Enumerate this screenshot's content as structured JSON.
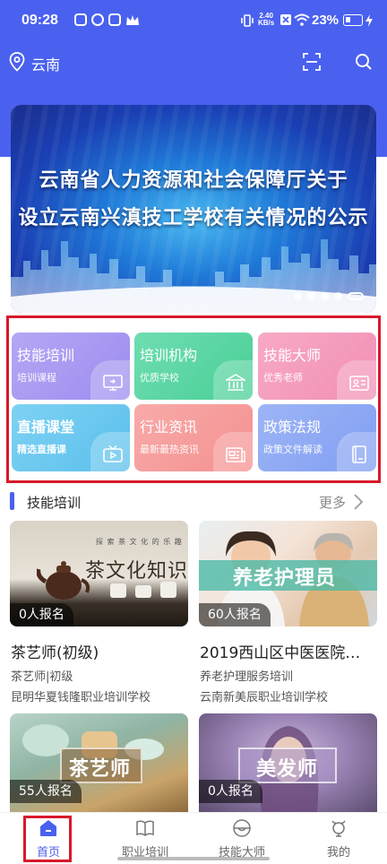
{
  "status_bar": {
    "time": "09:28",
    "net_speed_value": "2.40",
    "net_speed_unit": "KB/s",
    "battery": "23%"
  },
  "location": {
    "city": "云南"
  },
  "banner": {
    "line1": "云南省人力资源和社会保障厅关于",
    "line2": "设立云南兴滇技工学校有关情况的公示"
  },
  "categories": [
    {
      "title": "技能培训",
      "subtitle": "培训课程",
      "icon": "monitor-icon",
      "color_from": "#b6a6f4",
      "color_to": "#9d8df0"
    },
    {
      "title": "培训机构",
      "subtitle": "优质学校",
      "icon": "bank-icon",
      "color_from": "#6fddb1",
      "color_to": "#49cf97"
    },
    {
      "title": "技能大师",
      "subtitle": "优秀老师",
      "icon": "id-card-icon",
      "color_from": "#f7a9c6",
      "color_to": "#f28fb4"
    },
    {
      "title": "直播课堂",
      "subtitle": "精选直播课",
      "icon": "tv-play-icon",
      "color_from": "#7ed2f3",
      "color_to": "#5bbfec"
    },
    {
      "title": "行业资讯",
      "subtitle": "最新最热资讯",
      "icon": "newspaper-icon",
      "color_from": "#f8aaa9",
      "color_to": "#f49190"
    },
    {
      "title": "政策法规",
      "subtitle": "政策文件解读",
      "icon": "book-icon",
      "color_from": "#9db5f6",
      "color_to": "#819ef2"
    }
  ],
  "section": {
    "title": "技能培训",
    "more": "更多"
  },
  "courses": [
    {
      "image_caption_top": "探 索 茶 文 化 的 乐 趣",
      "image_caption": "茶文化知识",
      "count": "0人报名",
      "title": "茶艺师(初级)",
      "line1": "茶艺师|初级",
      "line2": "昆明华夏钱隆职业培训学校"
    },
    {
      "image_caption": "养老护理员",
      "count": "60人报名",
      "title": "2019西山区中医医院…",
      "line1": "养老护理服务培训",
      "line2": "云南新美辰职业培训学校"
    },
    {
      "image_caption": "茶艺师",
      "count": "55人报名"
    },
    {
      "image_caption": "美发师",
      "count": "0人报名"
    }
  ],
  "bottom_nav": [
    {
      "label": "首页",
      "icon": "home-icon",
      "active": true
    },
    {
      "label": "职业培训",
      "icon": "book-open-icon",
      "active": false
    },
    {
      "label": "技能大师",
      "icon": "master-icon",
      "active": false
    },
    {
      "label": "我的",
      "icon": "profile-icon",
      "active": false
    }
  ],
  "colors": {
    "brand": "#4a61ef",
    "highlight_frame": "#d8182b"
  }
}
